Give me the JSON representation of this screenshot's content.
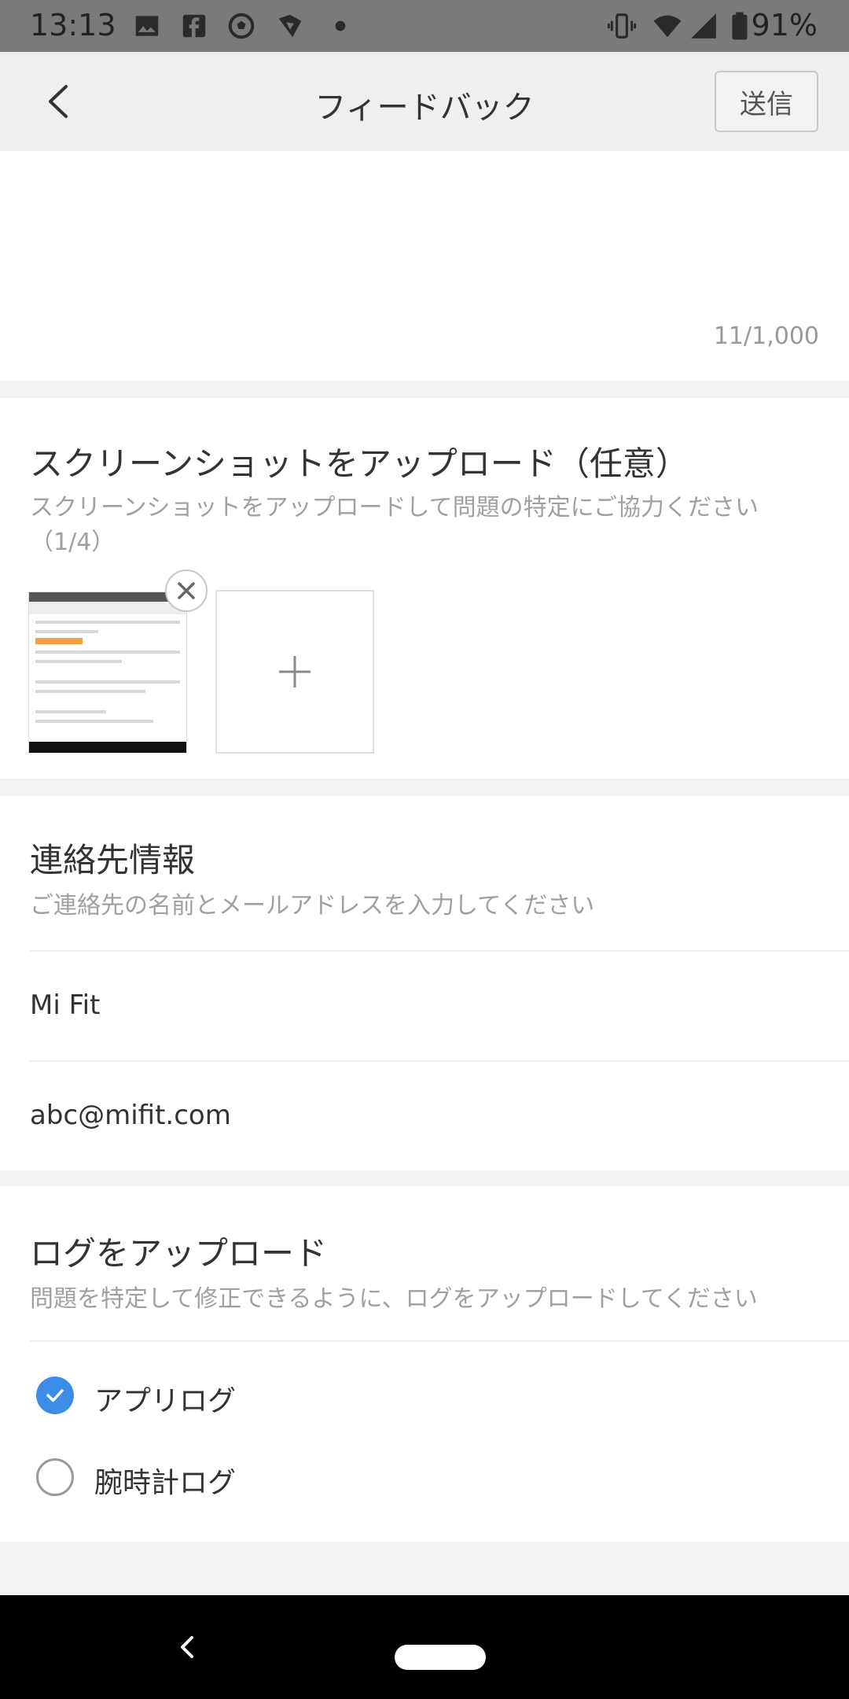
{
  "status_bar": {
    "time": "13:13",
    "battery": "91%",
    "icons": [
      "image-icon",
      "facebook-icon",
      "soccer-icon",
      "app-shield-icon",
      "dot-icon",
      "vibrate-icon",
      "wifi-icon",
      "signal-icon",
      "battery-icon"
    ]
  },
  "header": {
    "title": "フィードバック",
    "send_label": "送信",
    "back_icon": "chevron-left-icon"
  },
  "feedback": {
    "counter": "11/1,000"
  },
  "screenshots": {
    "title": "スクリーンショットをアップロード（任意）",
    "subtitle": "スクリーンショットをアップロードして問題の特定にご協力ください（1/4）",
    "add_icon": "plus-icon",
    "remove_icon": "close-icon"
  },
  "contact": {
    "title": "連絡先情報",
    "subtitle": "ご連絡先の名前とメールアドレスを入力してください",
    "name_value": "Mi Fit",
    "email_value": "abc@mifit.com"
  },
  "logs": {
    "title": "ログをアップロード",
    "subtitle": "問題を特定して修正できるように、ログをアップロードしてください",
    "options": [
      {
        "label": "アプリログ",
        "checked": true
      },
      {
        "label": "腕時計ログ",
        "checked": false
      }
    ]
  },
  "colors": {
    "accent": "#3d8ce6",
    "status_bar": "#7a7a7a",
    "header_bg": "#eeeff1"
  }
}
